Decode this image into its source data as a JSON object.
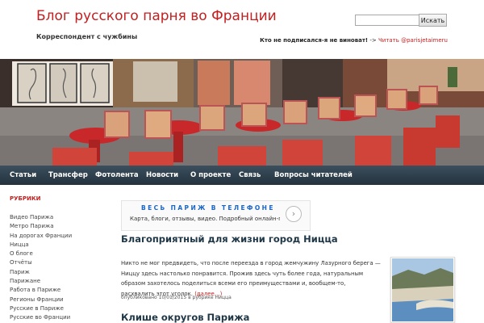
{
  "header": {
    "site_title": "Блог русского парня во Франции",
    "site_description": "Корреспондент с чужбины",
    "search": {
      "placeholder": "",
      "button_label": "Искать"
    },
    "promo": {
      "text": "Кто не подписался-я не виноват!",
      "arrow": " -> ",
      "link_label": "Читать @parisjetaimeru"
    }
  },
  "nav": {
    "items": [
      "Статьи",
      "Трансфер",
      "Фотолента",
      "Новости",
      "О проекте",
      "Связь",
      "Вопросы читателей"
    ]
  },
  "sidebar": {
    "heading": "РУБРИКИ",
    "items": [
      "Видео Парижа",
      "Метро Парижа",
      "На дорогах Франции",
      "Ницца",
      "О блоге",
      "Отчёты",
      "Париж",
      "Парижане",
      "Работа в Париже",
      "Регионы Франции",
      "Русские в Париже",
      "Русские во Франции"
    ]
  },
  "ad": {
    "title": "ВЕСЬ ПАРИЖ В ТЕЛЕФОНЕ",
    "text": "Карта, блоги, отзывы, видео. Подробный онлайн-гид",
    "arrow_icon": "chevron-right-icon"
  },
  "posts": [
    {
      "title": "Благоприятный для жизни город Ницца",
      "excerpt": "Никто не мог предвидеть, что после переезда в город жемчужину Лазурного берега — Ниццу здесь настолько понравится. Прожив здесь чуть более года, натуральным образом захотелось поделиться всеми его преимуществами и, вообщем-то, расхвалить этот уголок.",
      "more_label": "(далее…)",
      "meta_prefix": "опубликовано 10/01/2015 в рубрике ",
      "category": "Ницца"
    },
    {
      "title": "Клише округов Парижа"
    }
  ],
  "colors": {
    "accent": "#c41e1e",
    "nav_bg": "#2c3c48",
    "title_color": "#1f3746"
  }
}
